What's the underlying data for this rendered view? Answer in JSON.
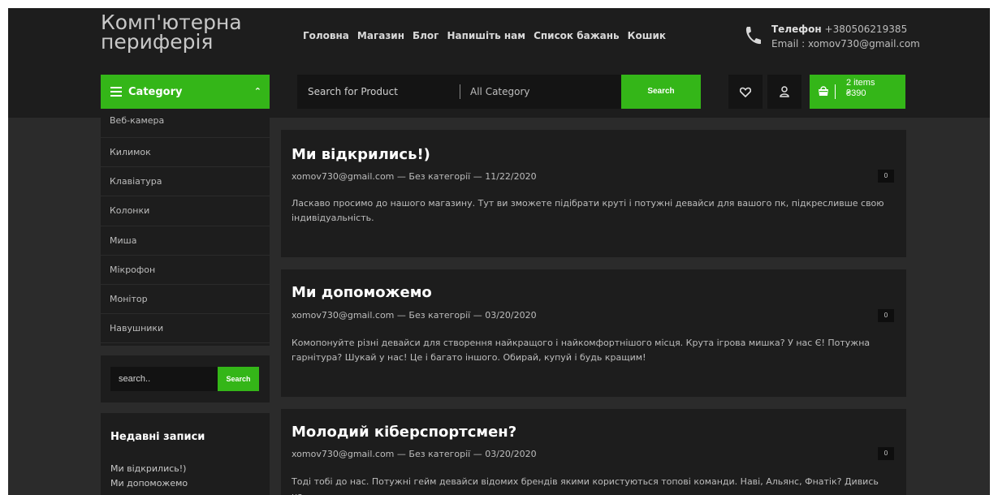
{
  "header": {
    "logo": "Комп'ютерна периферія",
    "logo_line1": "Комп'ютерна",
    "logo_line2": "периферія",
    "nav": [
      "Головна",
      "Магазин",
      "Блог",
      "Напишіть нам",
      "Список бажань",
      "Кошик"
    ],
    "contact": {
      "phone_label": "Телефон",
      "phone": "+380506219385",
      "email_line": "Email : xomov730@gmail.com"
    }
  },
  "toolbar": {
    "category_label": "Category",
    "search_placeholder": "Search for Product",
    "category_select": "All Category",
    "search_button": "Search",
    "cart_items": "2 items",
    "cart_total": "₴390"
  },
  "sidebar": {
    "categories": [
      "Веб-камера",
      "Килимок",
      "Клавіатура",
      "Колонки",
      "Миша",
      "Мікрофон",
      "Монітор",
      "Навушники"
    ],
    "search_placeholder": "search..",
    "search_button": "Search",
    "recent_title": "Недавні записи",
    "recent_posts": [
      "Ми відкрились!)",
      "Ми допоможемо"
    ]
  },
  "posts": [
    {
      "title": "Ми відкрились!)",
      "author": "xomov730@gmail.com",
      "category": "Без категорії",
      "date": "11/22/2020",
      "comments": "0",
      "excerpt": "Ласкаво просимо до нашого магазину. Тут ви зможете підібрати круті і потужні девайси для вашого пк, підкресливше свою індивідуальність."
    },
    {
      "title": "Ми допоможемо",
      "author": "xomov730@gmail.com",
      "category": "Без категорії",
      "date": "03/20/2020",
      "comments": "0",
      "excerpt": "Комопонуйте різні девайси для створення найкращого і найкомфортнішого місця. Крута ігрова мишка? У нас Є! Потужна гарнітура? Шукай у нас! Це і багато іншого. Обирай, купуй і будь кращим!"
    },
    {
      "title": "Молодий кіберспортсмен?",
      "author": "xomov730@gmail.com",
      "category": "Без категорії",
      "date": "03/20/2020",
      "comments": "0",
      "excerpt": "Тоді тобі до нас. Потужні гейм девайси відомих брендів якими користуються топові команди. Наві, Альянс, Фнатік? Дивись на"
    }
  ],
  "colors": {
    "accent": "#34b618",
    "header_bg": "#1d1d1d",
    "page_bg": "#2b2b2b",
    "panel_bg": "#1d1d1d"
  }
}
